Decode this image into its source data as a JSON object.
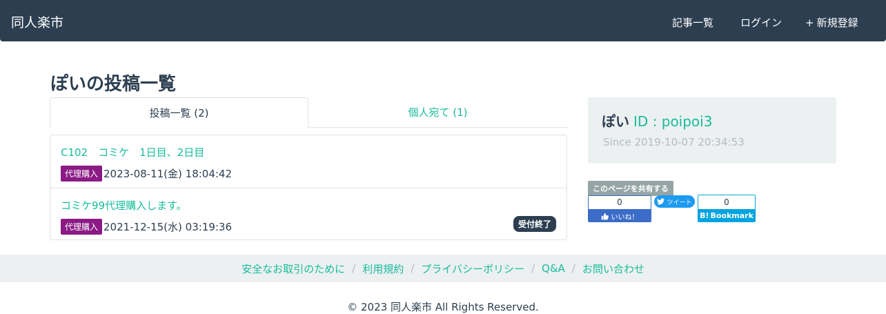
{
  "navbar": {
    "brand": "同人楽市",
    "links": [
      {
        "icon": "list-icon",
        "glyph": "",
        "label": "記事一覧"
      },
      {
        "icon": "login-icon",
        "glyph": "",
        "label": "ログイン"
      },
      {
        "icon": "plus-icon",
        "glyph": "+",
        "label": "新規登録"
      }
    ]
  },
  "main": {
    "title": "ぽいの投稿一覧",
    "tabs": [
      {
        "label": "投稿一覧 (2)",
        "active": true
      },
      {
        "label": "個人宛て (1)",
        "active": false
      }
    ],
    "posts": [
      {
        "title": "C102　コミケ　1日目、2日目",
        "category": "代理購入",
        "date": "2023-08-11(金) 18:04:42",
        "status": ""
      },
      {
        "title": "コミケ99代理購入します。",
        "category": "代理購入",
        "date": "2021-12-15(水) 03:19:36",
        "status": "受付終了"
      }
    ]
  },
  "profile": {
    "user_icon": "",
    "name": "ぽい",
    "id_label": "ID : poipoi3",
    "since_icon": "",
    "since": "Since 2019-10-07 20:34:53"
  },
  "share": {
    "label": "このページを共有する",
    "facebook": {
      "count": "0",
      "like_label": "いいね！"
    },
    "twitter": {
      "label": "ツイート"
    },
    "hatena": {
      "count": "0",
      "b_label": "B!",
      "bookmark_label": "Bookmark"
    }
  },
  "footer": {
    "links": [
      "安全なお取引のために",
      "利用規約",
      "プライバシーポリシー",
      "Q&A",
      "お問い合わせ"
    ],
    "separator": "/",
    "copyright": "© 2023 同人楽市 All Rights Reserved."
  },
  "colors": {
    "navbar": "#2c3e50",
    "accent": "#18bc9c",
    "category_badge": "#8b1a85",
    "facebook": "#3b6cc7",
    "twitter": "#1d9bf0",
    "hatena": "#00a4de"
  }
}
